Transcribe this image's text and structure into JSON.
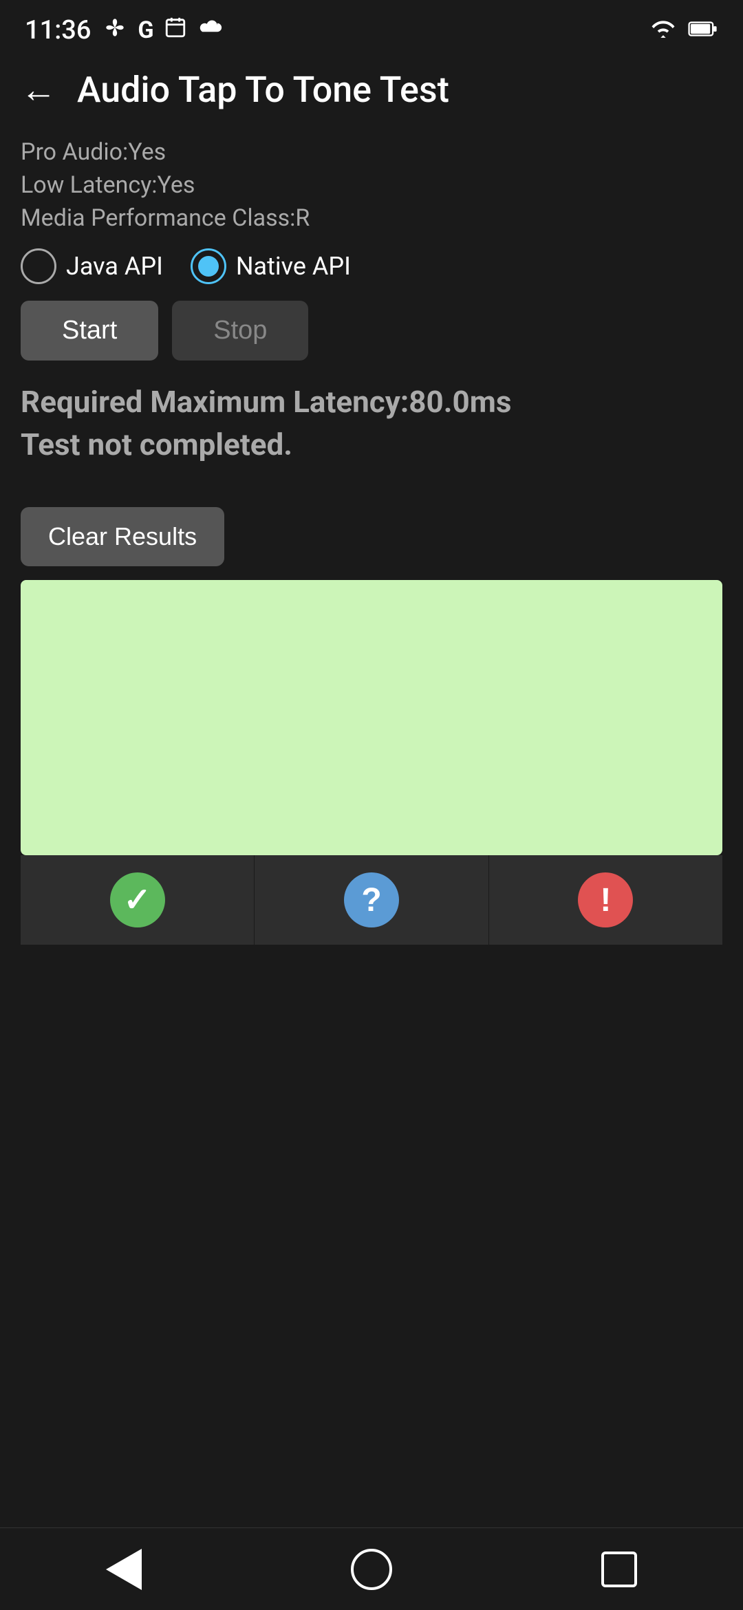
{
  "statusBar": {
    "time": "11:36",
    "icons": [
      "fan-icon",
      "google-icon",
      "calendar-icon",
      "cloud-icon"
    ],
    "wifi": "wifi-icon",
    "battery": "battery-icon"
  },
  "header": {
    "back_label": "←",
    "title": "Audio Tap To Tone Test"
  },
  "info": {
    "pro_audio": "Pro Audio:Yes",
    "low_latency": "Low Latency:Yes",
    "media_perf": "Media Performance Class:R"
  },
  "api_options": {
    "java_api": {
      "label": "Java API",
      "selected": false
    },
    "native_api": {
      "label": "Native API",
      "selected": true
    }
  },
  "buttons": {
    "start": "Start",
    "stop": "Stop"
  },
  "result": {
    "line1": "Required Maximum Latency:80.0ms",
    "line2": "Test not completed."
  },
  "clear_results": "Clear Results",
  "status_icons": {
    "check": "✓",
    "question": "?",
    "warning": "!"
  },
  "nav": {
    "back": "back-nav",
    "home": "home-nav",
    "recent": "recent-nav"
  }
}
